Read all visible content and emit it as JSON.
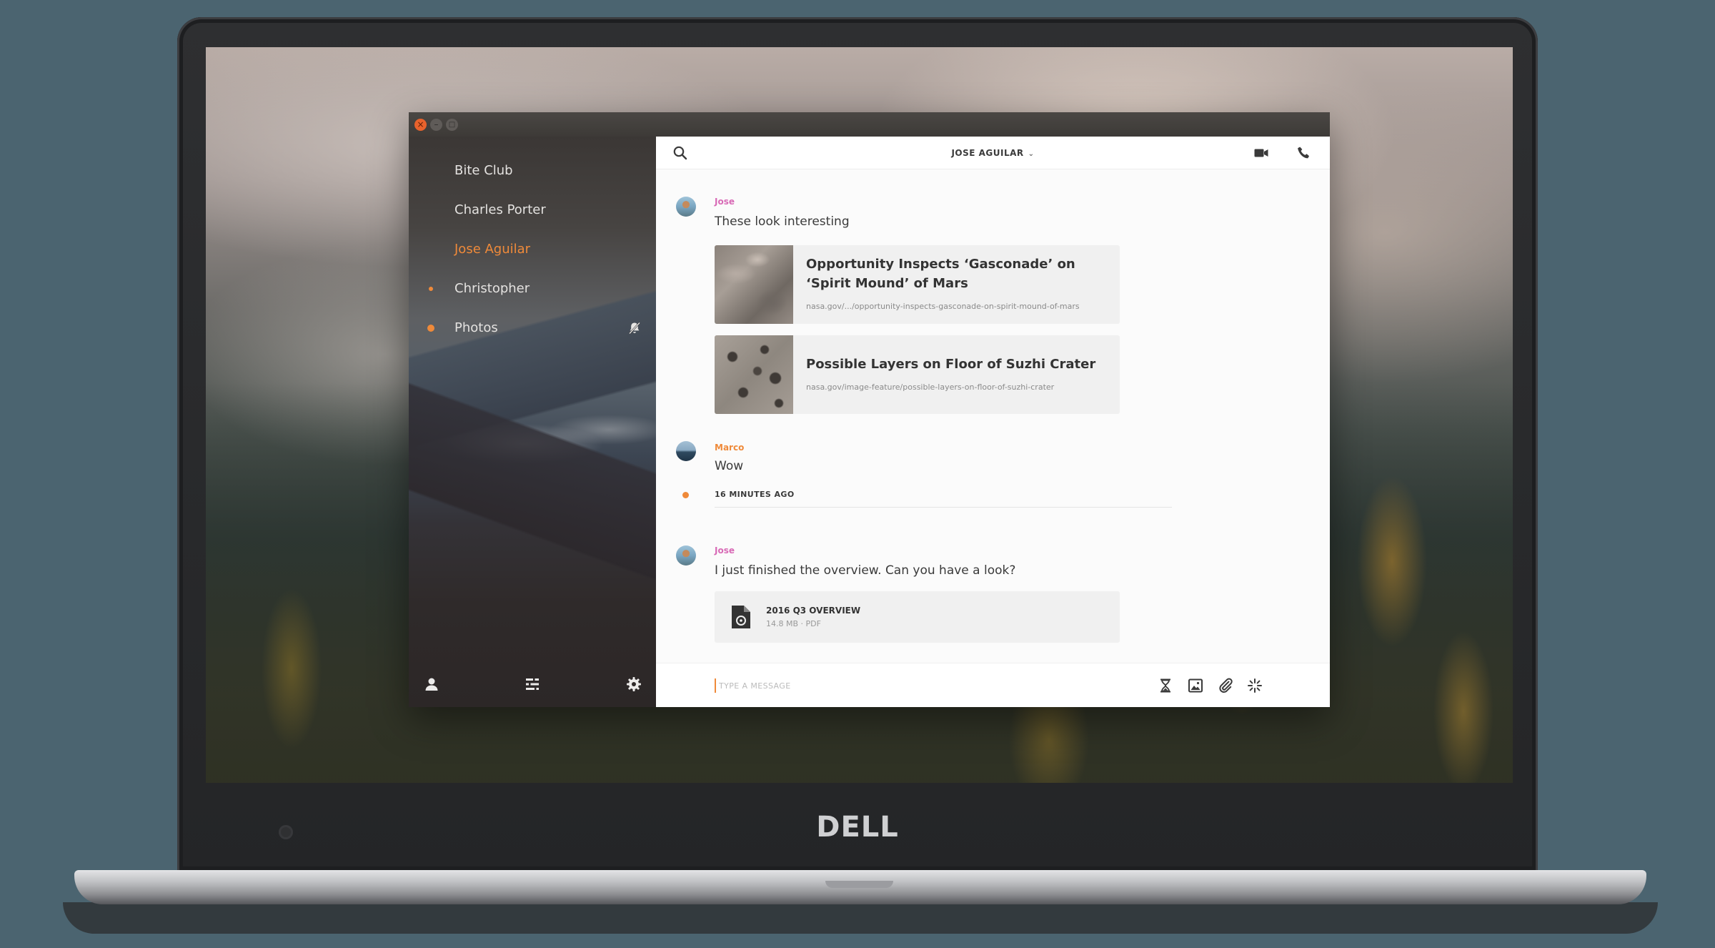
{
  "device": {
    "brand": "DELL"
  },
  "window": {
    "close_glyph": "×",
    "min_glyph": "–",
    "max_glyph": "□"
  },
  "sidebar": {
    "items": [
      {
        "label": "Bite Club",
        "active": false,
        "unread": false
      },
      {
        "label": "Charles Porter",
        "active": false,
        "unread": false
      },
      {
        "label": "Jose Aguilar",
        "active": true,
        "unread": false
      },
      {
        "label": "Christopher",
        "active": false,
        "unread": true
      },
      {
        "label": "Photos",
        "active": false,
        "unread": true,
        "muted": true
      }
    ],
    "footer_icons": [
      "user-icon",
      "sliders-icon",
      "gear-icon"
    ]
  },
  "conversation": {
    "title": "JOSE AGUILAR",
    "header_icons": [
      "search-icon",
      "video-camera-icon",
      "phone-icon"
    ]
  },
  "messages": {
    "m1": {
      "sender": "Jose",
      "text": "These look interesting",
      "links": [
        {
          "title": "Opportunity Inspects ‘Gasconade’ on ‘Spirit Mound’ of Mars",
          "url": "nasa.gov/.../opportunity-inspects-gasconade-on-spirit-mound-of-mars"
        },
        {
          "title": "Possible Layers on Floor of Suzhi Crater",
          "url": "nasa.gov/image-feature/possible-layers-on-floor-of-suzhi-crater"
        }
      ]
    },
    "m2": {
      "sender": "Marco",
      "text": "Wow"
    },
    "divider": "16 MINUTES AGO",
    "m3": {
      "sender": "Jose",
      "text": "I just finished the overview. Can you have a look?",
      "file": {
        "name": "2016 Q3 OVERVIEW",
        "meta": "14.8 MB · PDF"
      }
    }
  },
  "composer": {
    "placeholder": "TYPE A MESSAGE",
    "icons": [
      "hourglass-icon",
      "image-icon",
      "paperclip-icon",
      "sparkle-icon"
    ]
  },
  "colors": {
    "accent": "#ef8a3a",
    "jose": "#d86ab6",
    "marco": "#ef8a3a"
  }
}
